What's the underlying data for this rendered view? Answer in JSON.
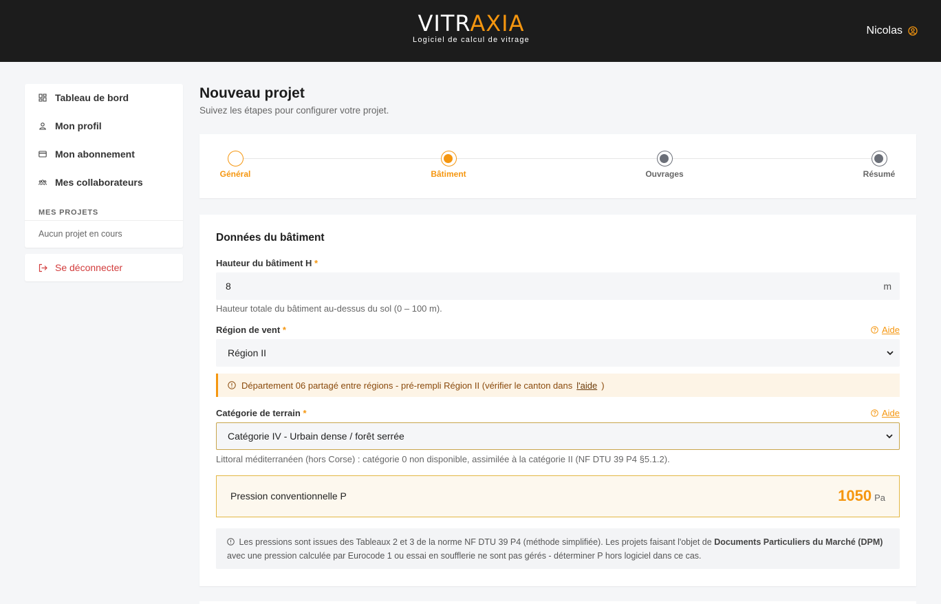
{
  "header": {
    "logo_part1": "VITR",
    "logo_part2": "AXIA",
    "tagline": "Logiciel de calcul de vitrage",
    "user_name": "Nicolas"
  },
  "sidebar": {
    "items": [
      {
        "label": "Tableau de bord",
        "icon": "dashboard-icon"
      },
      {
        "label": "Mon profil",
        "icon": "user-icon"
      },
      {
        "label": "Mon abonnement",
        "icon": "card-icon"
      },
      {
        "label": "Mes collaborateurs",
        "icon": "group-icon"
      }
    ],
    "section_title": "MES PROJETS",
    "empty_projects": "Aucun projet en cours",
    "logout_label": "Se déconnecter"
  },
  "page": {
    "title": "Nouveau projet",
    "subtitle": "Suivez les étapes pour configurer votre projet."
  },
  "stepper": {
    "steps": [
      {
        "label": "Général",
        "state": "done"
      },
      {
        "label": "Bâtiment",
        "state": "active"
      },
      {
        "label": "Ouvrages",
        "state": "todo"
      },
      {
        "label": "Résumé",
        "state": "todo"
      }
    ]
  },
  "form": {
    "section_title": "Données du bâtiment",
    "height": {
      "label": "Hauteur du bâtiment H",
      "required_mark": "*",
      "value": "8",
      "unit": "m",
      "hint": "Hauteur totale du bâtiment au-dessus du sol (0 – 100 m)."
    },
    "wind_region": {
      "label": "Région de vent",
      "required_mark": "*",
      "help": "Aide",
      "selected": "Région II"
    },
    "warning": {
      "text": "Département 06 partagé entre régions - pré-rempli Région II (vérifier le canton dans",
      "link": "l'aide",
      "suffix": ")"
    },
    "terrain": {
      "label": "Catégorie de terrain",
      "required_mark": "*",
      "help": "Aide",
      "selected": "Catégorie IV - Urbain dense / forêt serrée",
      "hint": "Littoral méditerranéen (hors Corse) : catégorie 0 non disponible, assimilée à la catégorie II (NF DTU 39 P4 §5.1.2)."
    },
    "pressure": {
      "label": "Pression conventionnelle P",
      "value": "1050",
      "unit": "Pa"
    },
    "note": {
      "part1": "Les pressions sont issues des Tableaux 2 et 3 de la norme NF DTU 39 P4 (méthode simplifiée). Les projets faisant l'objet de",
      "bold": "Documents Particuliers du Marché (DPM)",
      "part2": "avec une pression calculée par Eurocode 1 ou essai en soufflerie ne sont pas gérés - déterminer P hors logiciel dans ce cas."
    }
  },
  "colors": {
    "accent": "#f5960f",
    "header_bg": "#1c1c1c",
    "danger": "#d23b3b",
    "step_todo": "#6b6f78"
  }
}
